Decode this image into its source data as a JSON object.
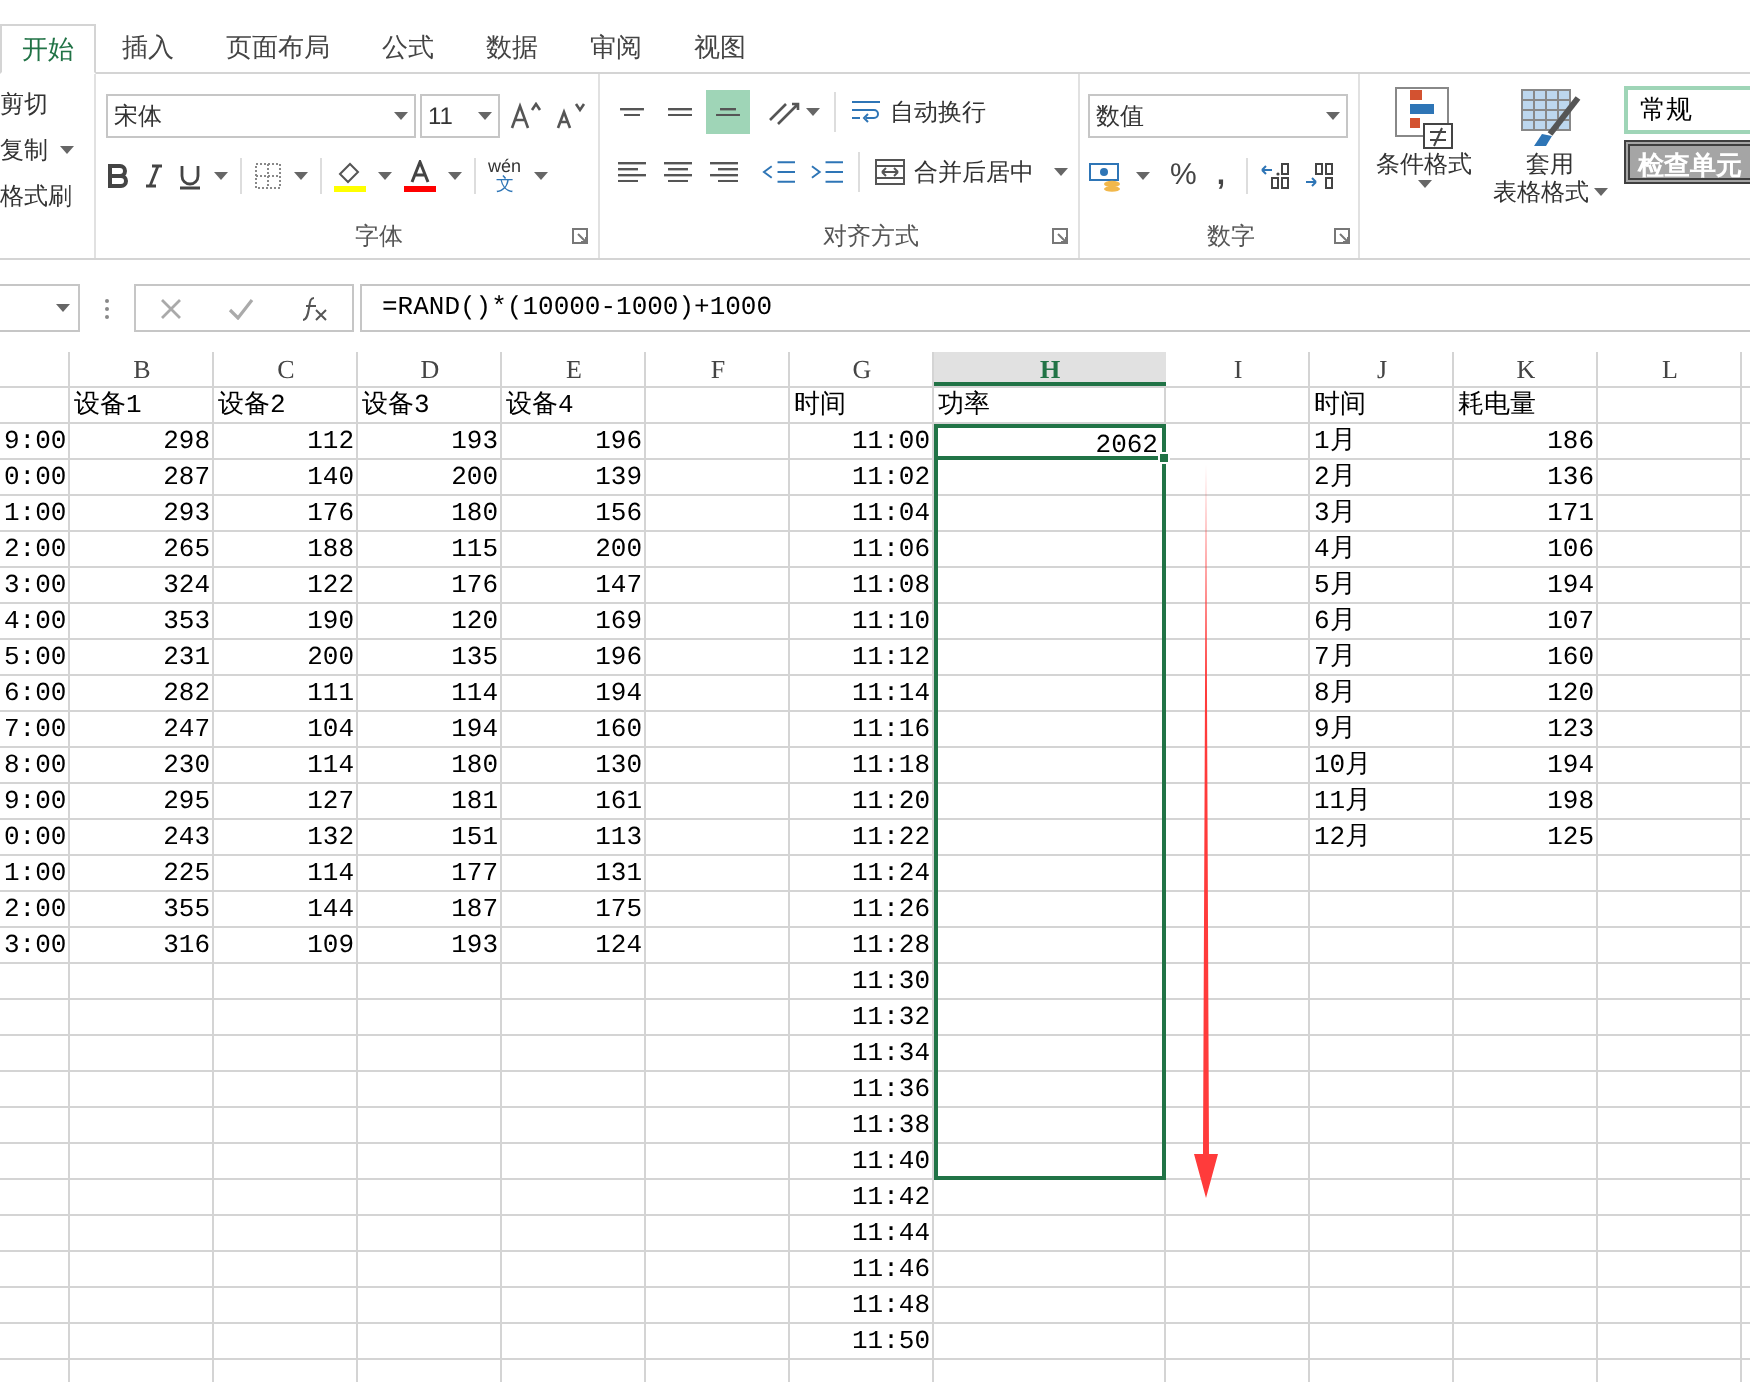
{
  "ribbon": {
    "tabs": [
      {
        "label": "开始",
        "selected": true
      },
      {
        "label": "插入",
        "selected": false
      },
      {
        "label": "页面布局",
        "selected": false
      },
      {
        "label": "公式",
        "selected": false
      },
      {
        "label": "数据",
        "selected": false
      },
      {
        "label": "审阅",
        "selected": false
      },
      {
        "label": "视图",
        "selected": false
      }
    ],
    "clipboard": {
      "items": [
        "剪切",
        "复制",
        "格式刷"
      ]
    },
    "font": {
      "name": "宋体",
      "size": "11",
      "phonetic_top": "wén",
      "phonetic_bottom": "文",
      "label": "字体"
    },
    "alignment": {
      "buttons": [
        {
          "kind": "top",
          "selected": false
        },
        {
          "kind": "middle",
          "selected": false
        },
        {
          "kind": "bottom",
          "selected": true
        }
      ],
      "wrap": "自动换行",
      "merge": "合并后居中",
      "label": "对齐方式"
    },
    "number": {
      "format": "数值",
      "percent": "%",
      "comma": ",",
      "label": "数字"
    },
    "styles": {
      "conditional": "条件格式",
      "table_line1": "套用",
      "table_line2": "表格格式",
      "cell_styles": [
        {
          "label": "常规",
          "kind": "normal"
        },
        {
          "label": "检查单元",
          "kind": "check"
        }
      ]
    }
  },
  "formula_bar": {
    "formula": "=RAND()*(10000-1000)+1000"
  },
  "sheet": {
    "columns": [
      {
        "label": "B",
        "selected": false
      },
      {
        "label": "C",
        "selected": false
      },
      {
        "label": "D",
        "selected": false
      },
      {
        "label": "E",
        "selected": false
      },
      {
        "label": "F",
        "selected": false
      },
      {
        "label": "G",
        "selected": false
      },
      {
        "label": "H",
        "selected": true
      },
      {
        "label": "I",
        "selected": false
      },
      {
        "label": "J",
        "selected": false
      },
      {
        "label": "K",
        "selected": false
      },
      {
        "label": "L",
        "selected": false
      }
    ],
    "devices": {
      "headers": [
        "设备1",
        "设备2",
        "设备3",
        "设备4"
      ],
      "rows": [
        {
          "time": "9:00",
          "values": [
            "298",
            "112",
            "193",
            "196"
          ]
        },
        {
          "time": "0:00",
          "values": [
            "287",
            "140",
            "200",
            "139"
          ]
        },
        {
          "time": "1:00",
          "values": [
            "293",
            "176",
            "180",
            "156"
          ]
        },
        {
          "time": "2:00",
          "values": [
            "265",
            "188",
            "115",
            "200"
          ]
        },
        {
          "time": "3:00",
          "values": [
            "324",
            "122",
            "176",
            "147"
          ]
        },
        {
          "time": "4:00",
          "values": [
            "353",
            "190",
            "120",
            "169"
          ]
        },
        {
          "time": "5:00",
          "values": [
            "231",
            "200",
            "135",
            "196"
          ]
        },
        {
          "time": "6:00",
          "values": [
            "282",
            "111",
            "114",
            "194"
          ]
        },
        {
          "time": "7:00",
          "values": [
            "247",
            "104",
            "194",
            "160"
          ]
        },
        {
          "time": "8:00",
          "values": [
            "230",
            "114",
            "180",
            "130"
          ]
        },
        {
          "time": "9:00",
          "values": [
            "295",
            "127",
            "181",
            "161"
          ]
        },
        {
          "time": "0:00",
          "values": [
            "243",
            "132",
            "151",
            "113"
          ]
        },
        {
          "time": "1:00",
          "values": [
            "225",
            "114",
            "177",
            "131"
          ]
        },
        {
          "time": "2:00",
          "values": [
            "355",
            "144",
            "187",
            "175"
          ]
        },
        {
          "time": "3:00",
          "values": [
            "316",
            "109",
            "193",
            "124"
          ]
        }
      ]
    },
    "power": {
      "time_header": "时间",
      "power_header": "功率",
      "rows": [
        {
          "time": "11:00",
          "power": "2062",
          "selected": true,
          "active": true
        },
        {
          "time": "11:02",
          "selected": true,
          "active": false
        },
        {
          "time": "11:04",
          "selected": true,
          "active": false
        },
        {
          "time": "11:06",
          "selected": true,
          "active": false
        },
        {
          "time": "11:08",
          "selected": true,
          "active": false
        },
        {
          "time": "11:10",
          "selected": true,
          "active": false
        },
        {
          "time": "11:12",
          "selected": true,
          "active": false
        },
        {
          "time": "11:14",
          "selected": true,
          "active": false
        },
        {
          "time": "11:16",
          "selected": true,
          "active": false
        },
        {
          "time": "11:18",
          "selected": true,
          "active": false
        },
        {
          "time": "11:20",
          "selected": true,
          "active": false
        },
        {
          "time": "11:22",
          "selected": true,
          "active": false
        },
        {
          "time": "11:24",
          "selected": true,
          "active": false
        },
        {
          "time": "11:26",
          "selected": true,
          "active": false
        },
        {
          "time": "11:28",
          "selected": true,
          "active": false
        },
        {
          "time": "11:30",
          "selected": true,
          "active": false
        },
        {
          "time": "11:32",
          "selected": true,
          "active": false
        },
        {
          "time": "11:34",
          "selected": true,
          "active": false
        },
        {
          "time": "11:36",
          "selected": true,
          "active": false
        },
        {
          "time": "11:38",
          "selected": true,
          "active": false
        },
        {
          "time": "11:40",
          "selected": true,
          "active": false
        },
        {
          "time": "11:42",
          "selected": false,
          "active": false
        },
        {
          "time": "11:44",
          "selected": false,
          "active": false
        },
        {
          "time": "11:46",
          "selected": false,
          "active": false
        },
        {
          "time": "11:48",
          "selected": false,
          "active": false
        },
        {
          "time": "11:50",
          "selected": false,
          "active": false
        }
      ]
    },
    "energy": {
      "headers": [
        "时间",
        "耗电量"
      ],
      "rows": [
        {
          "month": "1月",
          "value": "186"
        },
        {
          "month": "2月",
          "value": "136"
        },
        {
          "month": "3月",
          "value": "171"
        },
        {
          "month": "4月",
          "value": "106"
        },
        {
          "month": "5月",
          "value": "194"
        },
        {
          "month": "6月",
          "value": "107"
        },
        {
          "month": "7月",
          "value": "160"
        },
        {
          "month": "8月",
          "value": "120"
        },
        {
          "month": "9月",
          "value": "123"
        },
        {
          "month": "10月",
          "value": "194"
        },
        {
          "month": "11月",
          "value": "198"
        },
        {
          "month": "12月",
          "value": "125"
        }
      ]
    }
  }
}
